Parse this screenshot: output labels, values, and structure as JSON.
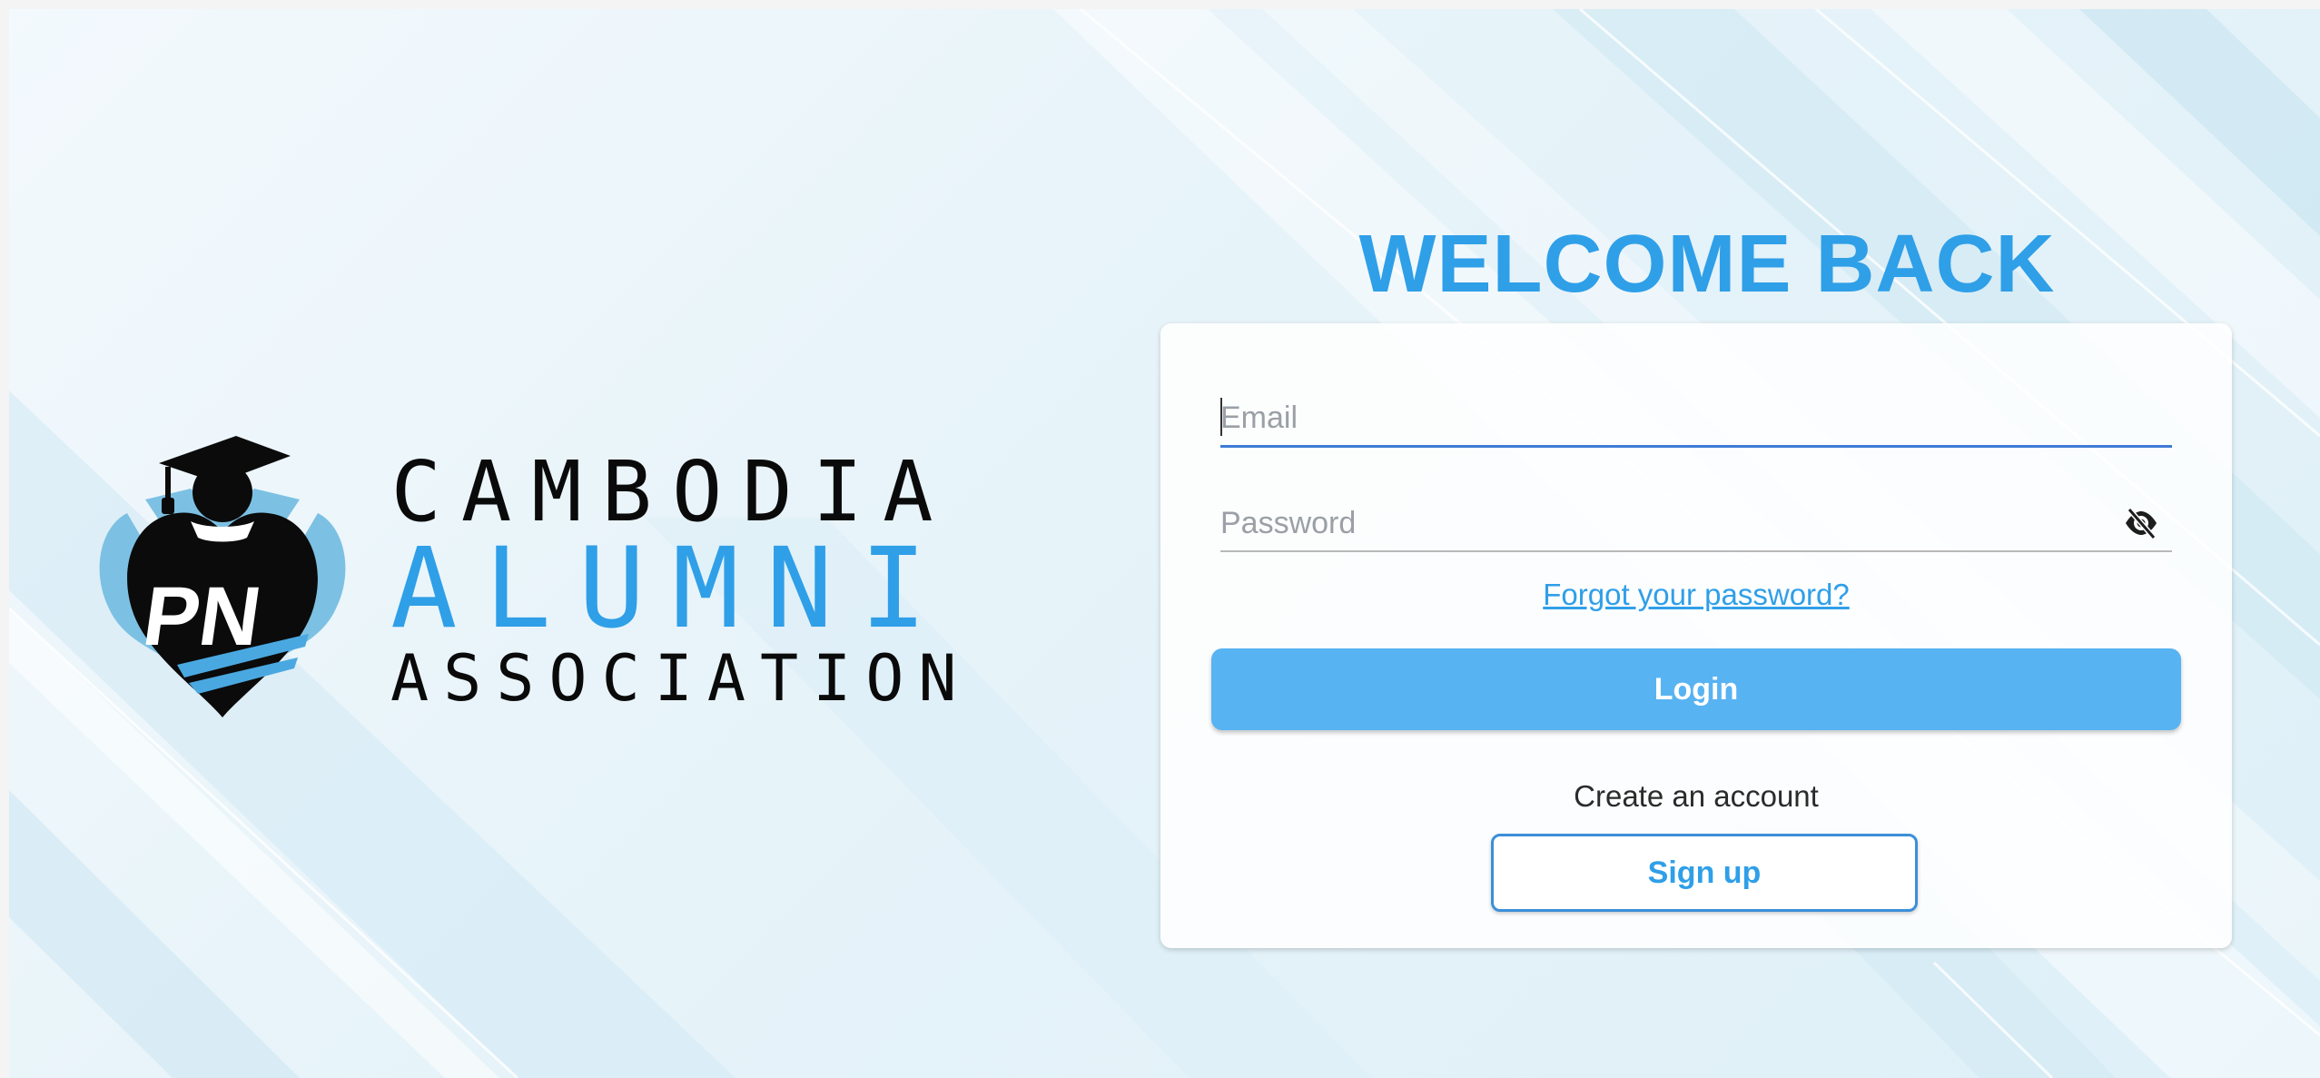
{
  "logo": {
    "monogram": "PN",
    "line1": "CAMBODIA",
    "line2": "ALUMNI",
    "line3": "ASSOCIATION"
  },
  "login": {
    "title": "WELCOME BACK",
    "email_placeholder": "Email",
    "email_value": "",
    "password_placeholder": "Password",
    "password_value": "",
    "password_toggle_icon": "eye-slash-icon",
    "forgot_link": "Forgot your password?",
    "login_button": "Login",
    "create_account_text": "Create an account",
    "signup_button": "Sign up"
  },
  "colors": {
    "accent": "#2f9fe8",
    "login_button": "#58b3f2",
    "focus_underline": "#3f7bd6",
    "logo_dark": "#0a0a0a"
  }
}
